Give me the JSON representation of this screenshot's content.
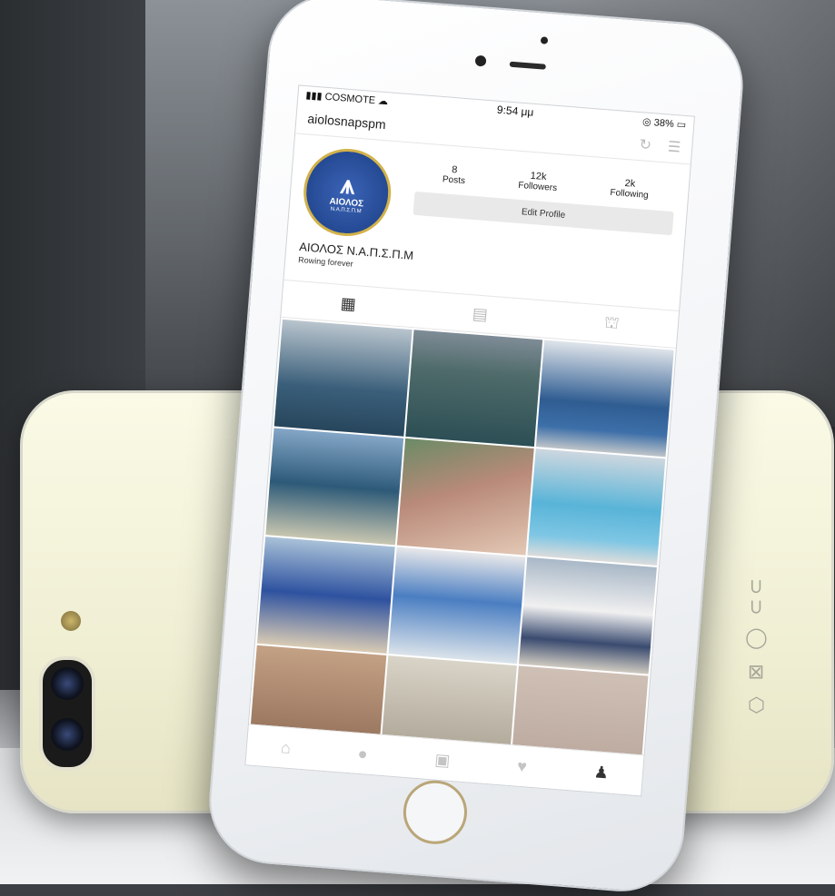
{
  "status_bar": {
    "carrier": "COSMOTE",
    "time": "9:54 μμ",
    "battery": "38%"
  },
  "profile": {
    "username": "aiolosnapspm",
    "display_name": "ΑΙΟΛΟΣ Ν.Α.Π.Σ.Π.Μ",
    "bio": "Rowing forever",
    "avatar_text": "ΑΙΟΛΟΣ",
    "avatar_subtext": "Ν.Α.Π.Σ.Π.Μ",
    "stats": [
      {
        "value": "8",
        "label": "Posts"
      },
      {
        "value": "12k",
        "label": "Followers"
      },
      {
        "value": "2k",
        "label": "Following"
      }
    ],
    "edit_button": "Edit Profile"
  },
  "tabs": [
    {
      "icon": "grid-icon",
      "active": true
    },
    {
      "icon": "list-icon",
      "active": false
    },
    {
      "icon": "tagged-icon",
      "active": false
    }
  ],
  "bottom_nav": [
    {
      "icon": "home-icon",
      "active": false
    },
    {
      "icon": "search-icon",
      "active": false
    },
    {
      "icon": "camera-icon",
      "active": false
    },
    {
      "icon": "heart-icon",
      "active": false
    },
    {
      "icon": "profile-icon",
      "active": true
    }
  ]
}
